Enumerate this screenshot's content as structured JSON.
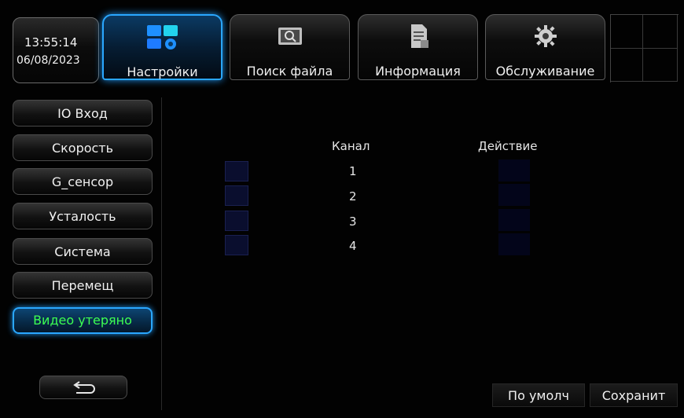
{
  "status": {
    "time": "13:55:14",
    "date": "06/08/2023"
  },
  "tabs": [
    {
      "label": "Настройки",
      "icon": "settings-tiles-icon",
      "active": true
    },
    {
      "label": "Поиск файла",
      "icon": "search-icon",
      "active": false
    },
    {
      "label": "Информация",
      "icon": "document-icon",
      "active": false
    },
    {
      "label": "Обслуживание",
      "icon": "gear-icon",
      "active": false
    }
  ],
  "sidebar": {
    "items": [
      {
        "label": "IO Вход"
      },
      {
        "label": "Скорость"
      },
      {
        "label": "G_сенсор"
      },
      {
        "label": "Усталость"
      },
      {
        "label": "Система"
      },
      {
        "label": "Перемещ"
      },
      {
        "label": "Видео утеряно",
        "active": true
      }
    ],
    "back_icon": "return-arrow-icon"
  },
  "table": {
    "col_channel": "Канал",
    "col_action": "Действие",
    "rows": [
      {
        "channel": "1"
      },
      {
        "channel": "2"
      },
      {
        "channel": "3"
      },
      {
        "channel": "4"
      }
    ]
  },
  "footer": {
    "default_label": "По умолч",
    "save_label": "Сохранит"
  },
  "colors": {
    "accent": "#2aa7ff",
    "active_text": "#3dff52"
  }
}
